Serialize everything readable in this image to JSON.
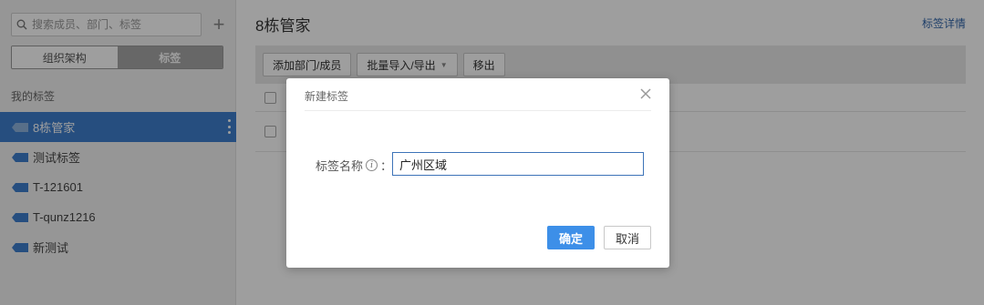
{
  "sidebar": {
    "search_placeholder": "搜索成员、部门、标签",
    "add_symbol": "+",
    "tabs": [
      {
        "label": "组织架构",
        "active": false
      },
      {
        "label": "标签",
        "active": true
      }
    ],
    "section_title": "我的标签",
    "tags": [
      {
        "label": "8栋管家",
        "active": true
      },
      {
        "label": "测试标签",
        "active": false
      },
      {
        "label": "T-121601",
        "active": false
      },
      {
        "label": "T-qunz1216",
        "active": false
      },
      {
        "label": "新测试",
        "active": false
      }
    ]
  },
  "main": {
    "title": "8栋管家",
    "detail_link": "标签详情",
    "toolbar": {
      "add_label": "添加部门/成员",
      "import_export_label": "批量导入/导出",
      "remove_label": "移出"
    }
  },
  "dialog": {
    "title": "新建标签",
    "field_label": "标签名称",
    "info_glyph": "i",
    "colon": "：",
    "input_value": "广州区域",
    "ok_label": "确定",
    "cancel_label": "取消"
  },
  "colors": {
    "active_tag_bg": "#3e7fce",
    "primary_button": "#3d8fe8",
    "link": "#3366aa"
  }
}
